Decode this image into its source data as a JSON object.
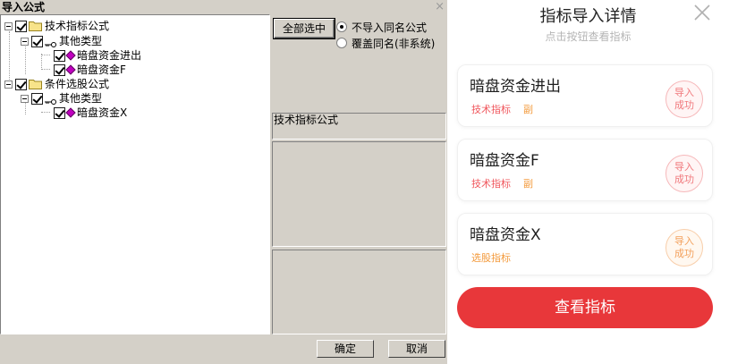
{
  "dialog": {
    "title": "导入公式",
    "close_glyph": "×",
    "tree": [
      {
        "level": 0,
        "label": "技术指标公式",
        "icon": "folder-icon",
        "checked": true
      },
      {
        "level": 1,
        "label": "其他类型",
        "icon": "key-icon",
        "checked": true
      },
      {
        "level": 2,
        "label": "暗盘资金进出",
        "icon": "gem-icon",
        "checked": true
      },
      {
        "level": 2,
        "label": "暗盘资金F",
        "icon": "gem-icon",
        "checked": true
      },
      {
        "level": 0,
        "label": "条件选股公式",
        "icon": "folder-icon",
        "checked": true
      },
      {
        "level": 1,
        "label": "其他类型",
        "icon": "key-icon",
        "checked": true
      },
      {
        "level": 2,
        "label": "暗盘资金X",
        "icon": "gem-icon",
        "checked": true
      }
    ],
    "select_all_label": "全部选中",
    "radio_options": [
      {
        "label": "不导入同名公式",
        "selected": true
      },
      {
        "label": "覆盖同名(非系统)",
        "selected": false
      }
    ],
    "preview_label": "技术指标公式",
    "ok_label": "确定",
    "cancel_label": "取消"
  },
  "sheet": {
    "title": "指标导入详情",
    "subtitle": "点击按钮查看指标",
    "close_glyph": "close-icon",
    "cards": [
      {
        "name": "暗盘资金进出",
        "tags": [
          {
            "text": "技术指标",
            "tone": "red"
          },
          {
            "text": "副",
            "tone": "orange"
          }
        ],
        "status_line1": "导入",
        "status_line2": "成功",
        "status_tone": "red"
      },
      {
        "name": "暗盘资金F",
        "tags": [
          {
            "text": "技术指标",
            "tone": "red"
          },
          {
            "text": "副",
            "tone": "orange"
          }
        ],
        "status_line1": "导入",
        "status_line2": "成功",
        "status_tone": "red"
      },
      {
        "name": "暗盘资金X",
        "tags": [
          {
            "text": "选股指标",
            "tone": "orange"
          }
        ],
        "status_line1": "导入",
        "status_line2": "成功",
        "status_tone": "orange"
      }
    ],
    "view_button_label": "查看指标"
  },
  "colors": {
    "dialog_bg": "#d4d0c8",
    "accent_red": "#e8373a",
    "tag_red": "#f0575d",
    "tag_orange": "#f39a3c",
    "checkmark_color": "#c000c0"
  }
}
